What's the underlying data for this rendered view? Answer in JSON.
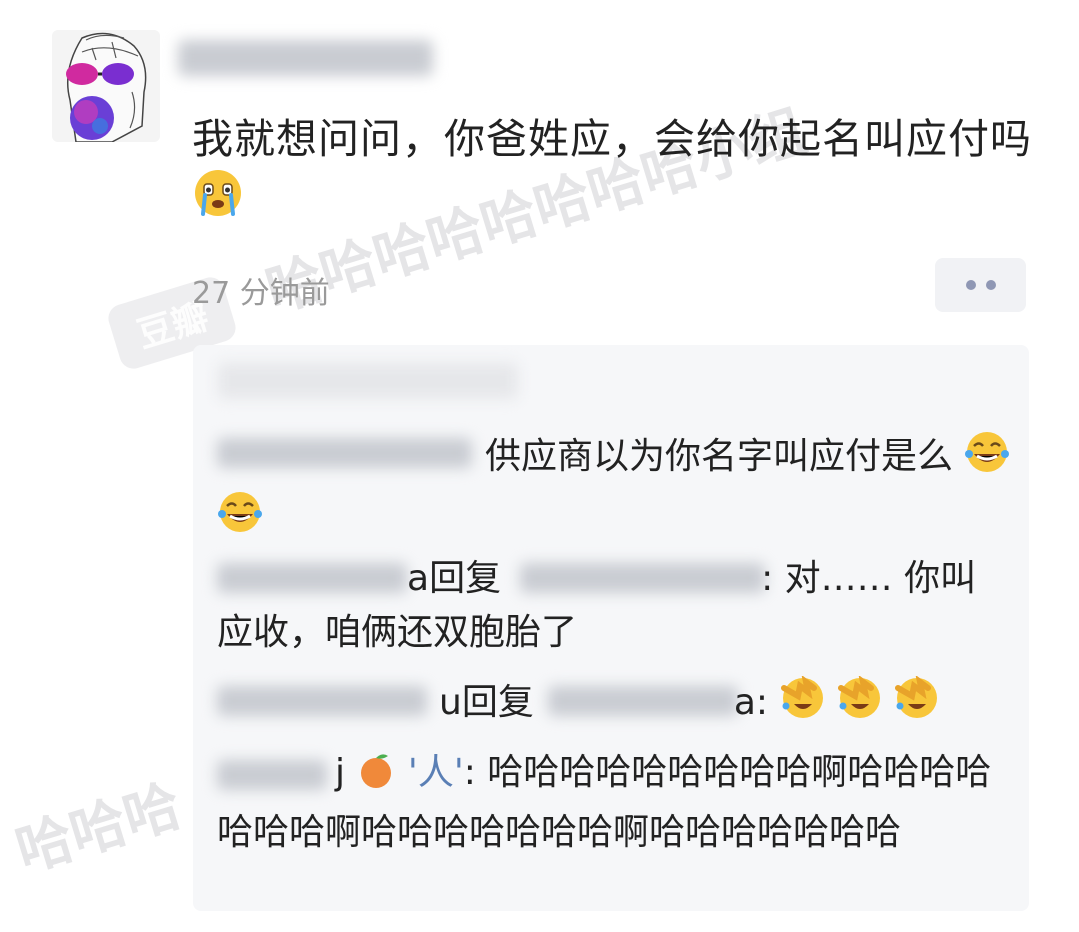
{
  "post": {
    "comment_text": "我就想问问，你爸姓应，会给你起名叫应付吗",
    "timestamp": "27 分钟前"
  },
  "watermark": {
    "logo": "豆瓣",
    "text_upper": "哈哈哈哈哈哈哈哈小组",
    "text_middle": "哈哈小组",
    "text_lower": "哈哈哈"
  },
  "replies": [
    {
      "author_tail": "",
      "text": "供应商以为你名字叫应付是么"
    },
    {
      "author_tail": "a",
      "reply_word": "回复",
      "target_tail": "",
      "text": ": 对…… 你叫应收，咱俩还双胞胎了"
    },
    {
      "author_tail": "u",
      "reply_word": "回复",
      "target_tail": "a",
      "text": ":"
    },
    {
      "author_tail": "j",
      "kaomoji": "'人'",
      "text": ": 哈哈哈哈哈哈哈哈哈啊哈哈哈哈哈哈哈啊哈哈哈哈哈哈哈啊哈哈哈哈哈哈哈"
    }
  ],
  "icons": {
    "more": "more-dots-icon",
    "crying_face": "crying-face-icon",
    "tears_of_joy": "tears-of-joy-icon",
    "facepalm": "facepalm-laughing-icon",
    "orange": "orange-fruit-icon"
  },
  "colors": {
    "text": "#222222",
    "timestamp": "#9a9a9a",
    "reply_box_bg": "#f6f7f9",
    "more_dot": "#8f97b4"
  }
}
